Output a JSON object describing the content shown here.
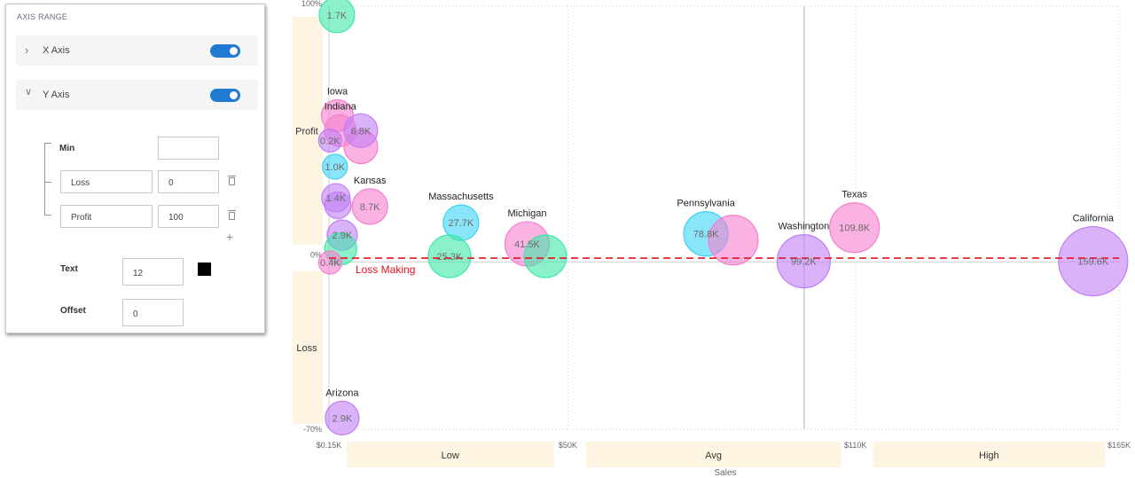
{
  "panel": {
    "title": "AXIS RANGE",
    "x_axis": {
      "label": "X Axis",
      "expanded": false,
      "enabled": true,
      "chevron_icon": "chevron-right-icon"
    },
    "y_axis": {
      "label": "Y Axis",
      "expanded": true,
      "enabled": true,
      "chevron_icon": "chevron-down-icon"
    },
    "min_label": "Min",
    "min_value": "",
    "ranges": [
      {
        "name": "Loss",
        "value": "0"
      },
      {
        "name": "Profit",
        "value": "100"
      }
    ],
    "text_label": "Text",
    "text_size": "12",
    "text_color": "#000000",
    "offset_label": "Offset",
    "offset_value": "0"
  },
  "chart_data": {
    "type": "scatter",
    "subtype": "bubble",
    "xlabel": "Sales",
    "ylabel": "",
    "xlim": [
      0.15,
      165
    ],
    "ylim": [
      -70,
      100
    ],
    "x_ticks": [
      {
        "value": 0.15,
        "label": "$0.15K"
      },
      {
        "value": 50,
        "label": "$50K"
      },
      {
        "value": 110,
        "label": "$110K"
      },
      {
        "value": 165,
        "label": "$165K"
      }
    ],
    "y_ticks": [
      {
        "value": 100,
        "label": "100%"
      },
      {
        "value": 0,
        "label": "0%"
      },
      {
        "value": -70,
        "label": "-70%"
      }
    ],
    "x_bands": [
      {
        "label": "Low",
        "from": 0.15,
        "to": 50
      },
      {
        "label": "Avg",
        "from": 50,
        "to": 110
      },
      {
        "label": "High",
        "from": 110,
        "to": 165
      }
    ],
    "y_bands": [
      {
        "label": "Profit",
        "from": 0,
        "to": 100
      },
      {
        "label": "Loss",
        "from": -70,
        "to": 0
      }
    ],
    "reference_lines": [
      {
        "axis": "y",
        "value": -2.3,
        "label": "Loss Making",
        "color": "#e81123",
        "style": "dashed"
      },
      {
        "axis": "x",
        "value": 99.3,
        "label": "",
        "color": "#cccccc",
        "style": "solid"
      }
    ],
    "colors": {
      "green": "#3ee8a8",
      "cyan": "#3ad3f5",
      "pink": "#f77fce",
      "purple": "#c27ef5"
    },
    "points": [
      {
        "label": "",
        "value_label": "1.7K",
        "x": 1.8,
        "y": 96.5,
        "size": 1.7,
        "color": "green"
      },
      {
        "label": "Iowa",
        "value_label": "",
        "x": 1.9,
        "y": 56,
        "size": 1.5,
        "color": "pink"
      },
      {
        "label": "Indiana",
        "value_label": "",
        "x": 2.5,
        "y": 50,
        "size": 1.5,
        "color": "pink"
      },
      {
        "label": "",
        "value_label": "",
        "x": 6.8,
        "y": 43.5,
        "size": 1.6,
        "color": "pink"
      },
      {
        "label": "",
        "value_label": "6.8K",
        "x": 6.8,
        "y": 50,
        "size": 1.6,
        "color": "purple"
      },
      {
        "label": "",
        "value_label": "0.2K",
        "x": 0.4,
        "y": 46,
        "size": 1.0,
        "color": "purple"
      },
      {
        "label": "",
        "value_label": "1.0K",
        "x": 1.4,
        "y": 35.5,
        "size": 1.1,
        "color": "cyan"
      },
      {
        "label": "",
        "value_label": "1.4K",
        "x": 1.6,
        "y": 23,
        "size": 1.3,
        "color": "purple"
      },
      {
        "label": "",
        "value_label": "",
        "x": 2.0,
        "y": 20,
        "size": 1.2,
        "color": "purple"
      },
      {
        "label": "Kansas",
        "value_label": "8.7K",
        "x": 8.7,
        "y": 19.5,
        "size": 1.7,
        "color": "pink"
      },
      {
        "label": "",
        "value_label": "2.9K",
        "x": 2.9,
        "y": 8,
        "size": 1.4,
        "color": "purple"
      },
      {
        "label": "",
        "value_label": "",
        "x": 2.6,
        "y": 2.5,
        "size": 1.5,
        "color": "green"
      },
      {
        "label": "",
        "value_label": "0.4K",
        "x": 0.4,
        "y": -3,
        "size": 1.0,
        "color": "pink"
      },
      {
        "label": "Massachusetts",
        "value_label": "27.7K",
        "x": 27.7,
        "y": 13,
        "size": 1.7,
        "color": "cyan"
      },
      {
        "label": "",
        "value_label": "25.3K",
        "x": 25.3,
        "y": -0.5,
        "size": 2.1,
        "color": "green"
      },
      {
        "label": "Michigan",
        "value_label": "41.5K",
        "x": 41.5,
        "y": 4.5,
        "size": 2.2,
        "color": "pink"
      },
      {
        "label": "",
        "value_label": "",
        "x": 45.3,
        "y": -0.5,
        "size": 2.1,
        "color": "green"
      },
      {
        "label": "Pennsylvania",
        "value_label": "78.8K",
        "x": 78.8,
        "y": 8.5,
        "size": 2.2,
        "color": "cyan"
      },
      {
        "label": "",
        "value_label": "",
        "x": 84.5,
        "y": 6,
        "size": 2.5,
        "color": "pink"
      },
      {
        "label": "Washington",
        "value_label": "99.2K",
        "x": 99.2,
        "y": -2.5,
        "size": 2.7,
        "color": "purple"
      },
      {
        "label": "Texas",
        "value_label": "109.8K",
        "x": 109.8,
        "y": 11,
        "size": 2.5,
        "color": "pink"
      },
      {
        "label": "California",
        "value_label": "159.6K",
        "x": 159.6,
        "y": -2.5,
        "size": 3.6,
        "color": "purple"
      },
      {
        "label": "Arizona",
        "value_label": "2.9K",
        "x": 2.9,
        "y": -65.5,
        "size": 1.6,
        "color": "purple"
      }
    ]
  }
}
